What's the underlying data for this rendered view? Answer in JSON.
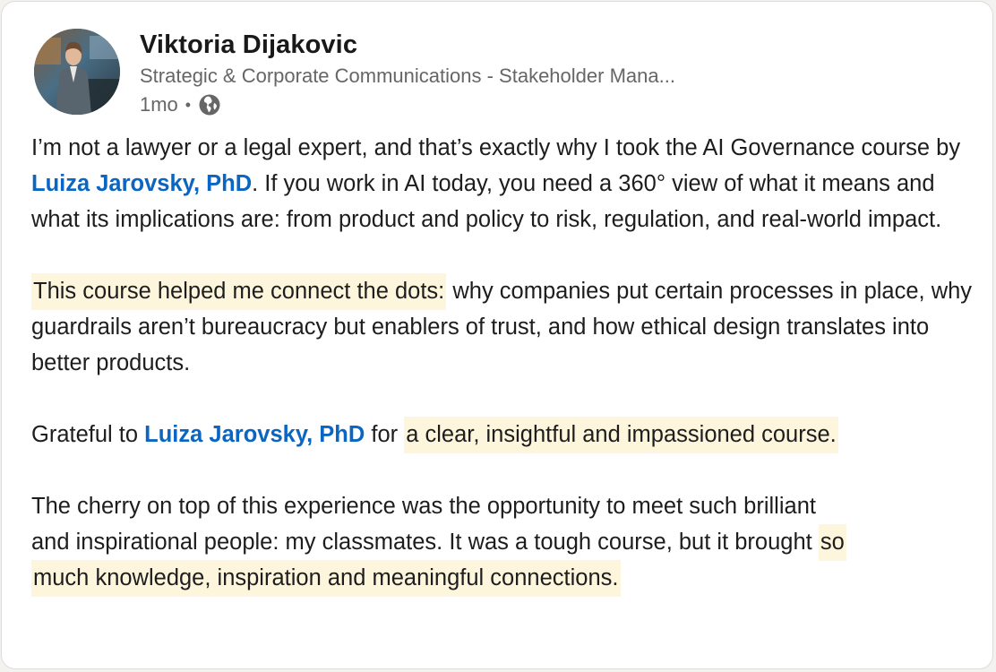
{
  "author": {
    "name": "Viktoria Dijakovic",
    "headline": "Strategic & Corporate Communications - Stakeholder Mana...",
    "time_ago": "1mo",
    "separator": "•",
    "visibility_icon": "globe-icon"
  },
  "post": {
    "p1": {
      "t1": "I’m not a lawyer or a legal expert, and that’s exactly why I took the AI Governance course by ",
      "mention": "Luiza Jarovsky, PhD",
      "t2": ". If you work in AI today, you need a 360° view of what it means and what its implications are: from product and policy to risk, regulation, and real-world impact."
    },
    "p2": {
      "highlight": "This course helped me connect the dots:",
      "t1": " why companies put certain processes in place, why guardrails aren’t bureaucracy but enablers of trust, and how ethical design translates into better products."
    },
    "p3": {
      "t1": "Grateful to ",
      "mention": "Luiza Jarovsky, PhD",
      "t2": " for ",
      "highlight": "a clear, insightful and impassioned course."
    },
    "p4": {
      "t1": "The cherry on top of this experience was the opportunity to meet such brilliant and inspirational people: my classmates. It was a tough course, but it brought ",
      "highlight": "so much knowledge, inspiration and meaningful connections."
    }
  },
  "colors": {
    "mention": "#0a66c2",
    "highlight": "#fdf6dd",
    "text": "#1d1d1d",
    "muted": "#666666"
  }
}
